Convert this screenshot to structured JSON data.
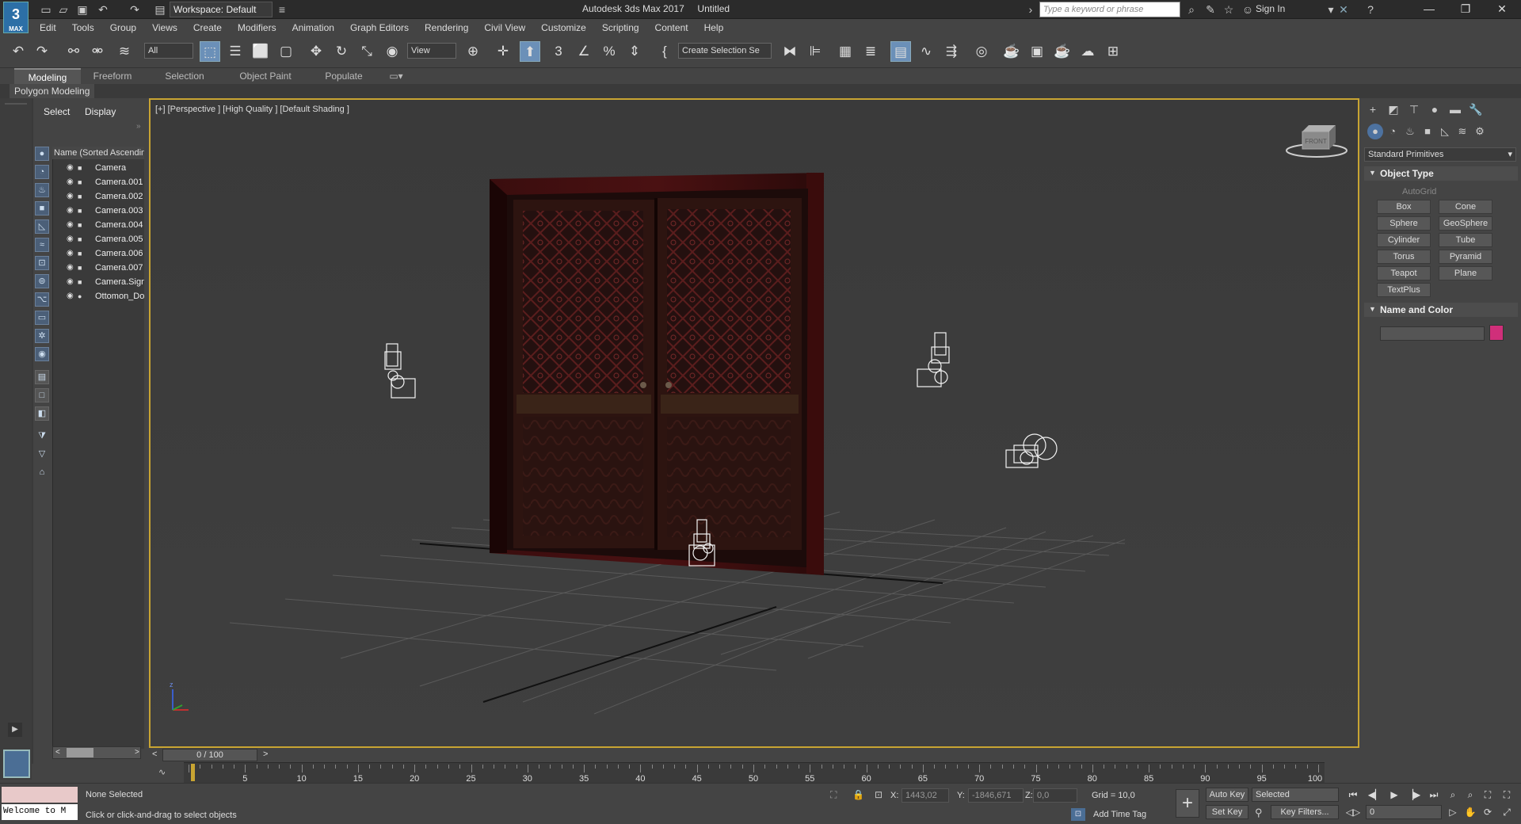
{
  "titlebar": {
    "logo": "3",
    "logo_sub": "MAX",
    "workspace": "Workspace: Default",
    "app_title": "Autodesk 3ds Max 2017     Untitled",
    "search_placeholder": "Type a keyword or phrase",
    "sign_in": "Sign In"
  },
  "menu": [
    "Edit",
    "Tools",
    "Group",
    "Views",
    "Create",
    "Modifiers",
    "Animation",
    "Graph Editors",
    "Rendering",
    "Civil View",
    "Customize",
    "Scripting",
    "Content",
    "Help"
  ],
  "toolbar": {
    "filter": "All",
    "ref_coord": "View",
    "selection_set": "Create Selection Se"
  },
  "ribbon": {
    "tabs": [
      "Modeling",
      "Freeform",
      "Selection",
      "Object Paint",
      "Populate"
    ],
    "active_tab": "Modeling",
    "panel_label": "Polygon Modeling"
  },
  "explorer": {
    "tabs": [
      "Select",
      "Display"
    ],
    "header": "Name (Sorted Ascendin",
    "items": [
      {
        "name": "Camera",
        "type": "camera"
      },
      {
        "name": "Camera.001",
        "type": "camera"
      },
      {
        "name": "Camera.002",
        "type": "camera"
      },
      {
        "name": "Camera.003",
        "type": "camera"
      },
      {
        "name": "Camera.004",
        "type": "camera"
      },
      {
        "name": "Camera.005",
        "type": "camera"
      },
      {
        "name": "Camera.006",
        "type": "camera"
      },
      {
        "name": "Camera.007",
        "type": "camera"
      },
      {
        "name": "Camera.Sign",
        "type": "camera"
      },
      {
        "name": "Ottomon_Do",
        "type": "geometry"
      }
    ]
  },
  "viewport": {
    "label": "[+] [Perspective ] [High Quality ] [Default Shading ]",
    "viewcube_label": "FRONT"
  },
  "command_panel": {
    "category": "Standard Primitives",
    "object_type_title": "Object Type",
    "autogrid": "AutoGrid",
    "buttons": [
      "Box",
      "Cone",
      "Sphere",
      "GeoSphere",
      "Cylinder",
      "Tube",
      "Torus",
      "Pyramid",
      "Teapot",
      "Plane",
      "TextPlus"
    ],
    "name_color_title": "Name and Color",
    "color": "#d02f7a"
  },
  "timeline": {
    "slider": "0 / 100",
    "ticks": [
      "5",
      "10",
      "15",
      "20",
      "25",
      "30",
      "35",
      "40",
      "45",
      "50",
      "55",
      "60",
      "65",
      "70",
      "75",
      "80",
      "85",
      "90",
      "95",
      "100"
    ]
  },
  "status": {
    "maxscript": "Welcome to M",
    "selection": "None Selected",
    "prompt": "Click or click-and-drag to select objects",
    "x_label": "X:",
    "x": "1443,02",
    "y_label": "Y:",
    "y": "-1846,671",
    "z_label": "Z:",
    "z": "0,0",
    "grid": "Grid = 10,0",
    "add_time_tag": "Add Time Tag",
    "auto_key": "Auto Key",
    "set_key": "Set Key",
    "key_mode": "Selected",
    "key_filters": "Key Filters...",
    "frame": "0"
  }
}
